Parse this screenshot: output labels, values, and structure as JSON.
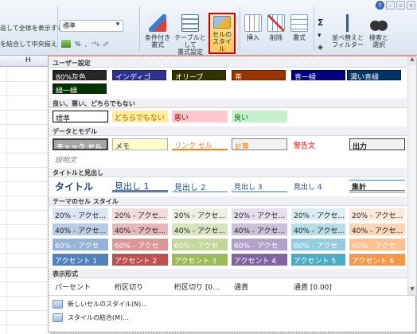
{
  "ribbon": {
    "wrap_text": "返して全体を表示する",
    "merge_center": "を結合して中央揃え",
    "number_format": "標準",
    "percent": "%",
    "comma": ",",
    "dec_inc": "⁺⁰₀",
    "dec_dec": "₀⁰",
    "buttons": {
      "conditional": [
        "条件付き",
        "書式"
      ],
      "table": [
        "テーブルとして",
        "書式設定"
      ],
      "cell_styles": [
        "セルの",
        "スタイル"
      ],
      "insert": "挿入",
      "delete": "削除",
      "format": "書式",
      "sort": [
        "並べ替えと",
        "フィルター"
      ],
      "find": [
        "検索と",
        "選択"
      ]
    }
  },
  "sheet": {
    "column": "H"
  },
  "gallery": {
    "sections": {
      "user": "ユーザー設定",
      "good_bad": "良い、悪い、どちらでもない",
      "data_model": "データとモデル",
      "titles": "タイトルと見出し",
      "theme": "テーマのセル スタイル",
      "number": "表示形式"
    },
    "user_styles": [
      "80%灰色",
      "インディゴ",
      "オリーブ",
      "茶",
      "青一緑",
      "濃い青緑",
      "緑一緑"
    ],
    "good_bad": [
      "標準",
      "どちらでもない",
      "悪い",
      "良い"
    ],
    "data_model": [
      "チェック セル",
      "メモ",
      "リンク セル",
      "計算",
      "警告文",
      "出力"
    ],
    "explanatory": "説明文",
    "titles": [
      "タイトル",
      "見出し 1",
      "見出し 2",
      "見出し 3",
      "見出し 4",
      "集計"
    ],
    "theme_20": [
      "20% - アクセ...",
      "20% - アクセ...",
      "20% - アクセ...",
      "20% - アクセ...",
      "20% - アクセ...",
      "20% - アクセ..."
    ],
    "theme_40": [
      "40% - アクセ...",
      "40% - アクセ...",
      "40% - アクセ...",
      "40% - アクセ...",
      "40% - アクセ...",
      "40% - アクセ..."
    ],
    "theme_60": [
      "60% - アクセ",
      "60% - アクセ",
      "60% - アクセ",
      "60% - アクセ",
      "60% - アクセ",
      "60% - アクセ"
    ],
    "accents": [
      "アクセント 1",
      "アクセント 2",
      "アクセント 3",
      "アクセント 4",
      "アクセント 5",
      "アクセント 6"
    ],
    "number_styles": [
      "パーセント",
      "桁区切り",
      "桁区切り [0...",
      "通貨",
      "通貨 [0.00]"
    ],
    "menu": {
      "new_style": "新しいセルのスタイル(N)...",
      "merge": "スタイルの結合(M)..."
    }
  },
  "colors": {
    "accent1": "#4f81bd",
    "accent2": "#c0504d",
    "accent3": "#9bbb59",
    "accent4": "#8064a2",
    "accent5": "#4bacc6",
    "accent6": "#f79646"
  }
}
